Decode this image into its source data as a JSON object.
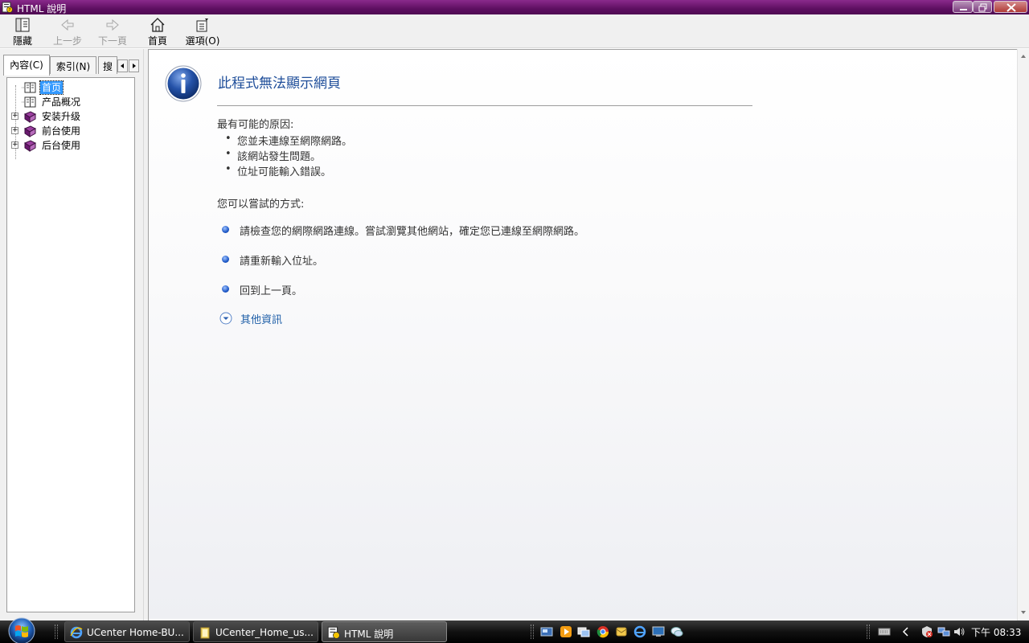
{
  "window": {
    "title": "HTML 說明"
  },
  "toolbar": {
    "hide": "隱藏",
    "back": "上一步",
    "forward": "下一頁",
    "home": "首頁",
    "options": "選項(O)"
  },
  "tabs": [
    {
      "label": "內容(C)"
    },
    {
      "label": "索引(N)"
    },
    {
      "label": "搜"
    }
  ],
  "tree": [
    {
      "label": "首页",
      "selected": true
    },
    {
      "label": "产品概况"
    },
    {
      "label": "安装升级"
    },
    {
      "label": "前台使用"
    },
    {
      "label": "后台使用"
    }
  ],
  "content": {
    "title": "此程式無法顯示網頁",
    "reasons_heading": "最有可能的原因:",
    "reasons": [
      "您並未連線至網際網路。",
      "該網站發生問題。",
      "位址可能輸入錯誤。"
    ],
    "try_heading": "您可以嘗試的方式:",
    "try_items": [
      "請檢查您的網際網路連線。嘗試瀏覽其他網站，確定您已連線至網際網路。",
      "請重新輸入位址。",
      "回到上一頁。"
    ],
    "more_info": "其他資訊"
  },
  "taskbar": {
    "tasks": [
      {
        "label": "UCenter Home-BU..."
      },
      {
        "label": "UCenter_Home_us..."
      },
      {
        "label": "HTML 說明"
      }
    ],
    "clock": "下午 08:33"
  },
  "icons": {
    "accent": "#5e0f61",
    "link": "#1f5fa8"
  }
}
